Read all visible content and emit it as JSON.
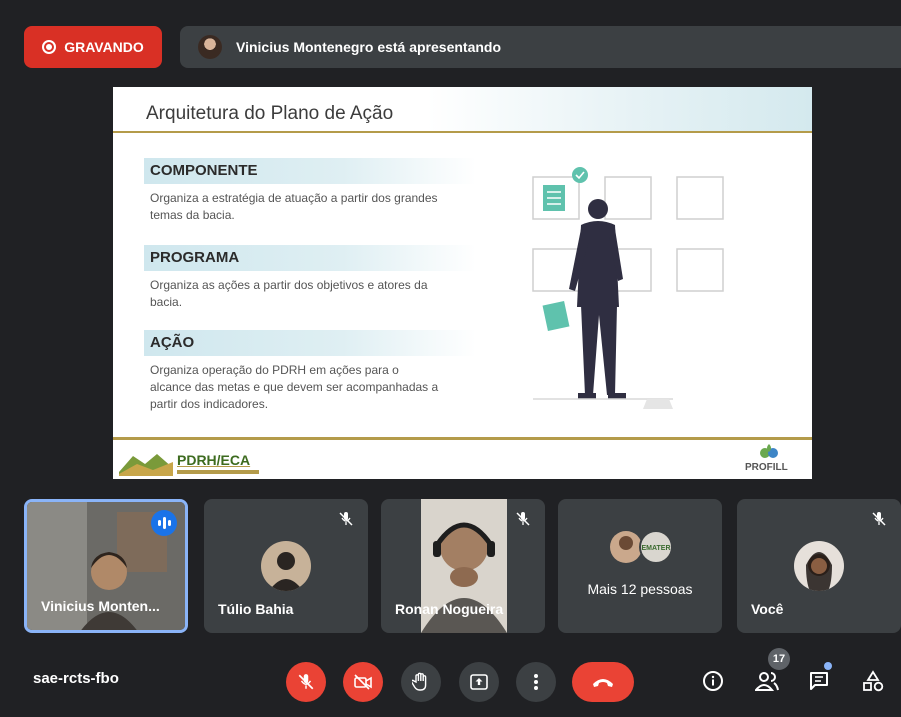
{
  "recording": {
    "label": "GRAVANDO"
  },
  "presenting": {
    "text": "Vinicius Montenegro está apresentando"
  },
  "slide": {
    "title": "Arquitetura do Plano de Ação",
    "sections": [
      {
        "heading": "COMPONENTE",
        "description": "Organiza a estratégia de atuação a partir dos grandes temas da bacia."
      },
      {
        "heading": "PROGRAMA",
        "description": "Organiza as ações a partir dos objetivos e atores da bacia."
      },
      {
        "heading": "AÇÃO",
        "description": "Organiza operação do PDRH em ações para o alcance das metas e que devem ser acompanhadas a partir dos indicadores."
      }
    ],
    "footer_left_logo": "PDRH/ECA",
    "footer_right_logo": "PROFILL"
  },
  "participants": [
    {
      "name": "Vinicius Monten...",
      "speaking": true
    },
    {
      "name": "Túlio Bahia",
      "muted": true
    },
    {
      "name": "Ronan Nogueira",
      "muted": true
    },
    {
      "name": "Mais 12 pessoas"
    },
    {
      "name": "Você",
      "muted": true
    }
  ],
  "footer": {
    "meeting_code": "sae-rcts-fbo",
    "people_count": "17"
  },
  "colors": {
    "record_red": "#d93025",
    "accent_blue": "#8ab4f8",
    "end_call": "#ea4335"
  }
}
